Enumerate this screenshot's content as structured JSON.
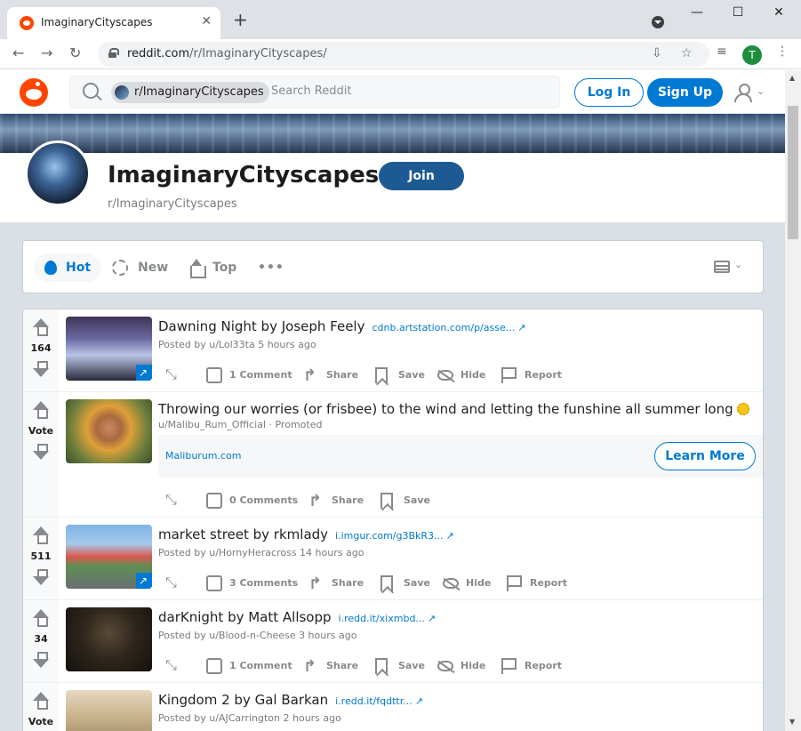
{
  "browser": {
    "tab_title": "ImaginaryCityscapes",
    "new_tab": "+",
    "url_host": "reddit.com",
    "url_path": "/r/ImaginaryCityscapes/",
    "profile_initial": "T",
    "window": {
      "minimize": "—",
      "maximize": "☐",
      "close": "✕"
    }
  },
  "header": {
    "search_chip": "r/ImaginaryCityscapes",
    "search_placeholder": "Search Reddit",
    "login": "Log In",
    "signup": "Sign Up"
  },
  "subreddit": {
    "title": "ImaginaryCityscapes",
    "name": "r/ImaginaryCityscapes",
    "join": "Join"
  },
  "sort": {
    "hot": "Hot",
    "new": "New",
    "top": "Top",
    "more": "•••"
  },
  "actions": {
    "share": "Share",
    "save": "Save",
    "hide": "Hide",
    "report": "Report"
  },
  "posts": [
    {
      "votes": "164",
      "title": "Dawning Night by Joseph Feely",
      "domain": "cdnb.artstation.com/p/asse...",
      "meta": "Posted by u/Lol33ta 5 hours ago",
      "comments": "1 Comment"
    },
    {
      "votes": "Vote",
      "title": "Throwing our worries (or frisbee) to the wind and letting the funshine all summer long",
      "meta": "u/Malibu_Rum_Official · Promoted",
      "promo_link": "Maliburum.com",
      "cta": "Learn More",
      "comments": "0 Comments"
    },
    {
      "votes": "511",
      "title": "market street by rkmlady",
      "domain": "i.imgur.com/g3BkR3...",
      "meta": "Posted by u/HornyHeracross 14 hours ago",
      "comments": "3 Comments"
    },
    {
      "votes": "34",
      "title": "darKnight by Matt Allsopp",
      "domain": "i.redd.it/xixmbd...",
      "meta": "Posted by u/Blood-n-Cheese 3 hours ago",
      "comments": "1 Comment"
    },
    {
      "votes": "Vote",
      "title": "Kingdom 2 by Gal Barkan",
      "domain": "i.redd.it/fqdttr...",
      "meta": "Posted by u/AJCarrington 2 hours ago"
    }
  ]
}
